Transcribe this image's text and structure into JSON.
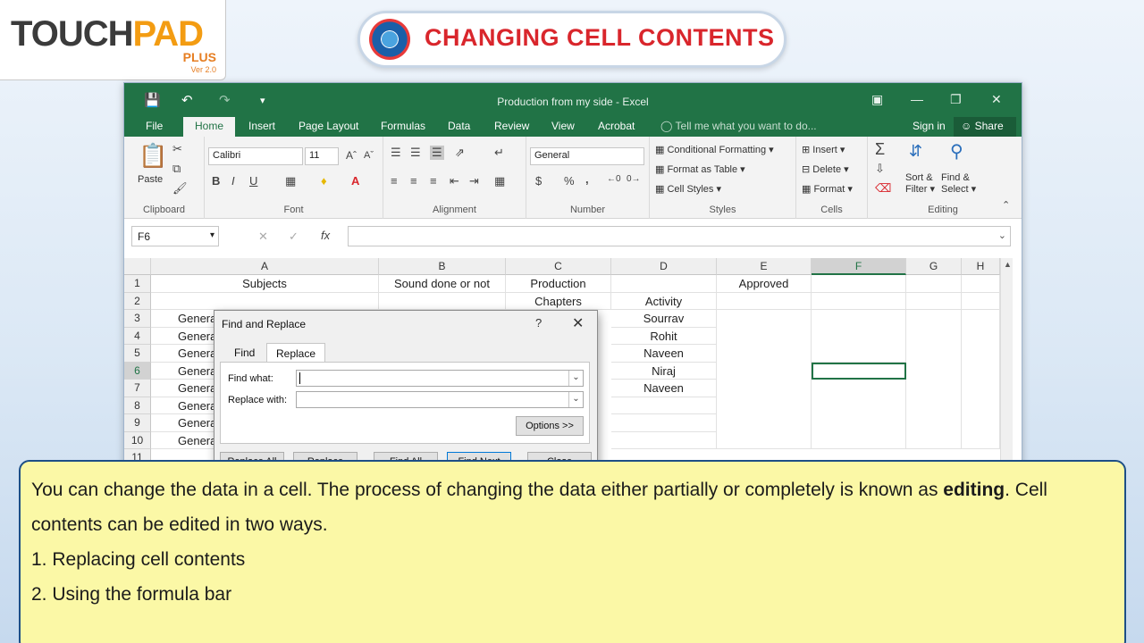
{
  "logo": {
    "main_a": "TOUCH",
    "main_b": "PAD",
    "plus": "PLUS",
    "version": "Ver 2.0"
  },
  "slide_title": "CHANGING CELL CONTENTS",
  "excel": {
    "window_title": "Production from my side - Excel",
    "tabs": [
      "File",
      "Home",
      "Insert",
      "Page Layout",
      "Formulas",
      "Data",
      "Review",
      "View",
      "Acrobat"
    ],
    "tell_me": "Tell me what you want to do...",
    "sign_in": "Sign in",
    "share": "Share",
    "ribbon": {
      "clipboard": {
        "label": "Clipboard",
        "paste": "Paste"
      },
      "font": {
        "label": "Font",
        "name": "Calibri",
        "size": "11",
        "bold": "B",
        "italic": "I",
        "underline": "U"
      },
      "alignment": {
        "label": "Alignment"
      },
      "number": {
        "label": "Number",
        "format": "General",
        "currency": "$",
        "percent": "%",
        "comma": ","
      },
      "styles": {
        "label": "Styles",
        "conditional": "Conditional Formatting",
        "format_table": "Format as Table",
        "cell_styles": "Cell Styles"
      },
      "cells": {
        "label": "Cells",
        "insert": "Insert",
        "delete": "Delete",
        "format": "Format"
      },
      "editing": {
        "label": "Editing",
        "sort": "Sort &",
        "filter": "Filter",
        "find": "Find &",
        "select": "Select"
      }
    },
    "name_box": "F6",
    "fx": "fx",
    "columns": [
      "A",
      "B",
      "C",
      "D",
      "E",
      "F",
      "G",
      "H"
    ],
    "rows": [
      "1",
      "2",
      "3",
      "4",
      "5",
      "6",
      "7",
      "8",
      "9",
      "10",
      "11"
    ],
    "cells": {
      "A1": "Subjects",
      "B1": "Sound done or not",
      "C1": "Production",
      "E1": "Approved",
      "C2": "Chapters",
      "D2": "Activity",
      "A3": "Genera",
      "A4": "Genera",
      "A5": "Genera",
      "A6": "Genera",
      "A7": "Genera",
      "A8": "Genera",
      "A9": "Genera",
      "A10": "Genera",
      "D3": "Sourrav",
      "D4": "Rohit",
      "D5": "Naveen",
      "D6": "Niraj",
      "D7": "Naveen"
    }
  },
  "dialog": {
    "title": "Find and Replace",
    "help": "?",
    "close": "✕",
    "tabs": [
      "Find",
      "Replace"
    ],
    "find_label": "Find what:",
    "replace_label": "Replace with:",
    "find_value": "",
    "replace_value": "",
    "options": "Options >>",
    "buttons": [
      "Replace All",
      "Replace",
      "Find All",
      "Find Next",
      "Close"
    ]
  },
  "info": {
    "line1_a": "You can change the data in a cell. The process of changing the data either partially or completely is known as ",
    "line1_bold": "editing",
    "line1_b": ". Cell contents can be edited in two ways.",
    "item1": "1. Replacing cell contents",
    "item2": "2. Using the formula bar"
  }
}
